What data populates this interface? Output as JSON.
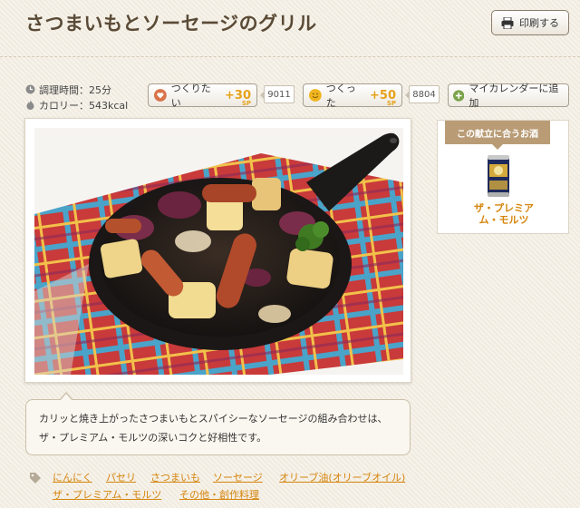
{
  "title": "さつまいもとソーセージのグリル",
  "print_button": {
    "label": "印刷する",
    "icon": "printer-icon"
  },
  "meta": {
    "cook_time": "調理時間：25分",
    "calories": "カロリー：543kcal"
  },
  "actions": {
    "want_to_make": {
      "label": "つくりたい",
      "points": "+30",
      "unit": "SP",
      "count": "9011",
      "icon": "heart-icon"
    },
    "made_it": {
      "label": "つくった",
      "points": "+50",
      "unit": "SP",
      "count": "8804",
      "icon": "smiley-icon"
    },
    "add_calendar": {
      "label": "マイカレンダーに追加",
      "icon": "plus-circle-icon"
    }
  },
  "pairing": {
    "header": "この献立に合うお酒",
    "beer_name_line1": "ザ・プレミア",
    "beer_name_line2": "ム・モルツ"
  },
  "description": "カリッと焼き上がったさつまいもとスパイシーなソーセージの組み合わせは、ザ・プレミアム・モルツの深いコクと好相性です。",
  "tags": [
    "にんにく",
    "パセリ",
    "さつまいも",
    "ソーセージ",
    "オリーブ油(オリーブオイル)",
    "ザ・プレミアム・モルツ",
    "その他・創作料理"
  ],
  "colors": {
    "accent": "#e5a21b",
    "link": "#d5850d",
    "title": "#5a4a36",
    "background": "#f4efe4"
  }
}
